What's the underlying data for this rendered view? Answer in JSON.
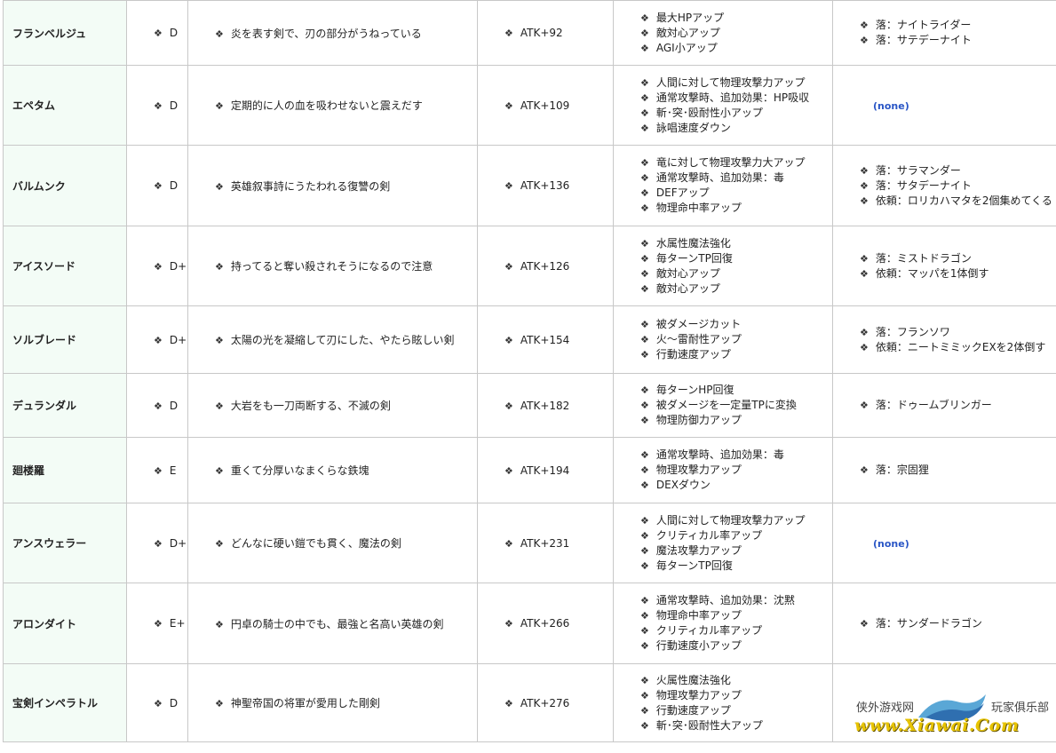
{
  "rows": [
    {
      "name": "フランベルジュ",
      "rank": "D",
      "desc": "炎を表す剣で、刃の部分がうねっている",
      "atk": "ATK+92",
      "effects": [
        "最大HPアップ",
        "敵対心アップ",
        "AGI小アップ"
      ],
      "sources": [
        "落：ナイトライダー",
        "落：サテデーナイト"
      ]
    },
    {
      "name": "エペタム",
      "rank": "D",
      "desc": "定期的に人の血を吸わせないと震えだす",
      "atk": "ATK+109",
      "effects": [
        "人間に対して物理攻撃力アップ",
        "通常攻撃時、追加効果：HP吸収",
        "斬･突･殴耐性小アップ",
        "詠唱速度ダウン"
      ],
      "sources": [],
      "none_label": "(none)"
    },
    {
      "name": "バルムンク",
      "rank": "D",
      "desc": "英雄叙事詩にうたわれる復讐の剣",
      "atk": "ATK+136",
      "effects": [
        "竜に対して物理攻撃力大アップ",
        "通常攻撃時、追加効果：毒",
        "DEFアップ",
        "物理命中率アップ"
      ],
      "sources": [
        "落：サラマンダー",
        "落：サタデーナイト",
        "依頼：ロリカハマタを2個集めてくる"
      ]
    },
    {
      "name": "アイスソード",
      "rank": "D+",
      "desc": "持ってると奪い殺されそうになるので注意",
      "atk": "ATK+126",
      "effects": [
        "水属性魔法強化",
        "毎ターンTP回復",
        "敵対心アップ",
        "敵対心アップ"
      ],
      "sources": [
        "落：ミストドラゴン",
        "依頼：マッパを1体倒す"
      ]
    },
    {
      "name": "ソルブレード",
      "rank": "D+",
      "desc": "太陽の光を凝縮して刃にした、やたら眩しい剣",
      "atk": "ATK+154",
      "effects": [
        "被ダメージカット",
        "火～雷耐性アップ",
        "行動速度アップ"
      ],
      "sources": [
        "落：フランソワ",
        "依頼：ニートミミックEXを2体倒す"
      ]
    },
    {
      "name": "デュランダル",
      "rank": "D",
      "desc": "大岩をも一刀両断する、不滅の剣",
      "atk": "ATK+182",
      "effects": [
        "毎ターンHP回復",
        "被ダメージを一定量TPに変換",
        "物理防御力アップ"
      ],
      "sources": [
        "落：ドゥームブリンガー"
      ]
    },
    {
      "name": "廻楼羅",
      "rank": "E",
      "desc": "重くて分厚いなまくらな鉄塊",
      "atk": "ATK+194",
      "effects": [
        "通常攻撃時、追加効果：毒",
        "物理攻撃力アップ",
        "DEXダウン"
      ],
      "sources": [
        "落：宗固狸"
      ]
    },
    {
      "name": "アンスウェラー",
      "rank": "D+",
      "desc": "どんなに硬い鎧でも貫く、魔法の剣",
      "atk": "ATK+231",
      "effects": [
        "人間に対して物理攻撃力アップ",
        "クリティカル率アップ",
        "魔法攻撃力アップ",
        "毎ターンTP回復"
      ],
      "sources": [],
      "none_label": "(none)"
    },
    {
      "name": "アロンダイト",
      "rank": "E+",
      "desc": "円卓の騎士の中でも、最強と名高い英雄の剣",
      "atk": "ATK+266",
      "effects": [
        "通常攻撃時、追加効果：沈黙",
        "物理命中率アップ",
        "クリティカル率アップ",
        "行動速度小アップ"
      ],
      "sources": [
        "落：サンダードラゴン"
      ]
    },
    {
      "name": "宝剣インペラトル",
      "rank": "D",
      "desc": "神聖帝国の将軍が愛用した剛剣",
      "atk": "ATK+276",
      "effects": [
        "火属性魔法強化",
        "物理攻撃力アップ",
        "行動速度アップ",
        "斬･突･殴耐性大アップ"
      ],
      "sources": []
    }
  ],
  "watermark": {
    "site_cn": "侠外游戏网",
    "club_cn": "玩家俱乐部",
    "url": "www.Xiawai.Com"
  }
}
